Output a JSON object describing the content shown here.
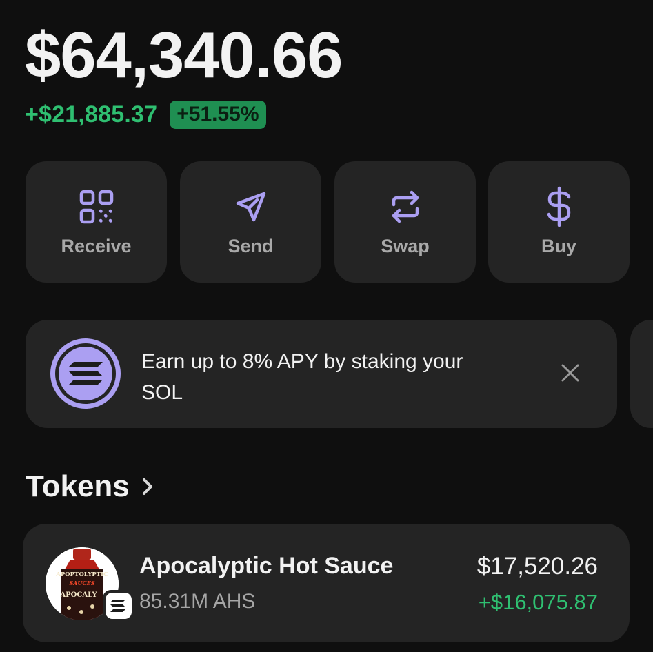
{
  "portfolio": {
    "balance": "$64,340.66",
    "change_amount": "+$21,885.37",
    "change_percent": "+51.55%"
  },
  "actions": [
    {
      "label": "Receive",
      "icon": "qr-code-icon"
    },
    {
      "label": "Send",
      "icon": "send-icon"
    },
    {
      "label": "Swap",
      "icon": "swap-icon"
    },
    {
      "label": "Buy",
      "icon": "dollar-icon"
    }
  ],
  "banner": {
    "text": "Earn up to 8% APY by staking your SOL",
    "icon": "solana-icon",
    "close_icon": "close-icon"
  },
  "tokens": {
    "title": "Tokens",
    "items": [
      {
        "name": "Apocalyptic Hot Sauce",
        "amount": "85.31M AHS",
        "value": "$17,520.26",
        "pnl": "+$16,075.87",
        "avatar_label_top": "APOPTOLYPTIC",
        "avatar_label_mid": "SAUCES",
        "avatar_label_bottom": "APOCALY"
      }
    ]
  },
  "colors": {
    "background": "#0f0f0f",
    "card": "#242424",
    "accent_purple": "#ab9ff2",
    "positive_green": "#2fbf71",
    "pill_green": "#1f8f52"
  }
}
